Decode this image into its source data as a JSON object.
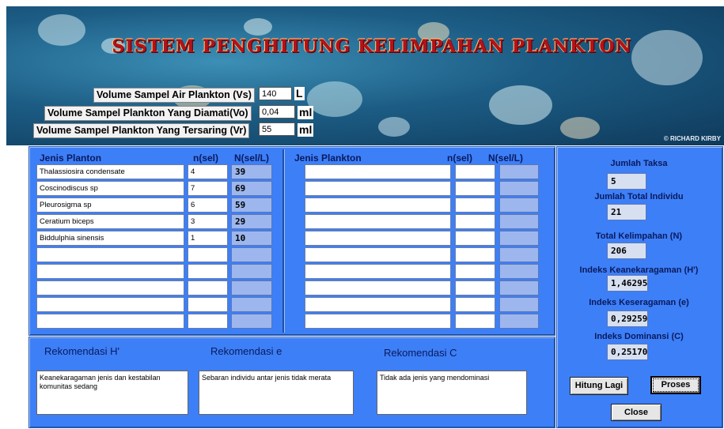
{
  "app": {
    "title": "SISTEM PENGHITUNG KELIMPAHAN PLANKTON",
    "banner_watermark": "© RICHARD KIRBY"
  },
  "volumes": [
    {
      "label": "Volume Sampel Air Plankton (Vs)",
      "value": "140",
      "unit": "L"
    },
    {
      "label": "Volume Sampel Plankton Yang Diamati(Vo)",
      "value": "0,04",
      "unit": "ml"
    },
    {
      "label": "Volume Sampel Plankton Yang Tersaring (Vr)",
      "value": "55",
      "unit": "ml"
    }
  ],
  "table_left": {
    "headers": {
      "jenis": "Jenis Planton",
      "n": "n(sel)",
      "N": "N(sel/L)"
    },
    "rows": [
      {
        "jenis": "Thalassiosira condensate",
        "n": "4",
        "N": "39"
      },
      {
        "jenis": "Coscinodiscus sp",
        "n": "7",
        "N": "69"
      },
      {
        "jenis": "Pleurosigma sp",
        "n": "6",
        "N": "59"
      },
      {
        "jenis": "Ceratium biceps",
        "n": "3",
        "N": "29"
      },
      {
        "jenis": "Biddulphia sinensis",
        "n": "1",
        "N": "10"
      },
      {
        "jenis": "",
        "n": "",
        "N": ""
      },
      {
        "jenis": "",
        "n": "",
        "N": ""
      },
      {
        "jenis": "",
        "n": "",
        "N": ""
      },
      {
        "jenis": "",
        "n": "",
        "N": ""
      },
      {
        "jenis": "",
        "n": "",
        "N": ""
      }
    ]
  },
  "table_right": {
    "headers": {
      "jenis": "Jenis Plankton",
      "n": "n(sel)",
      "N": "N(sel/L)"
    },
    "rows": [
      {
        "jenis": "",
        "n": "",
        "N": ""
      },
      {
        "jenis": "",
        "n": "",
        "N": ""
      },
      {
        "jenis": "",
        "n": "",
        "N": ""
      },
      {
        "jenis": "",
        "n": "",
        "N": ""
      },
      {
        "jenis": "",
        "n": "",
        "N": ""
      },
      {
        "jenis": "",
        "n": "",
        "N": ""
      },
      {
        "jenis": "",
        "n": "",
        "N": ""
      },
      {
        "jenis": "",
        "n": "",
        "N": ""
      },
      {
        "jenis": "",
        "n": "",
        "N": ""
      },
      {
        "jenis": "",
        "n": "",
        "N": ""
      }
    ]
  },
  "results": {
    "jumlah_taksa": {
      "label": "Jumlah Taksa",
      "value": "5"
    },
    "jumlah_total_individu": {
      "label": "Jumlah Total Individu",
      "value": "21"
    },
    "total_kelimpahan": {
      "label": "Total Kelimpahan (N)",
      "value": "206"
    },
    "indeks_keanekaragaman": {
      "label": "Indeks Keanekaragaman (H')",
      "value": "1,46295"
    },
    "indeks_keseragaman": {
      "label": "Indeks Keseragaman (e)",
      "value": "0,29259"
    },
    "indeks_dominansi": {
      "label": "Indeks Dominansi (C)",
      "value": "0,25170"
    }
  },
  "recommendations": {
    "h": {
      "label": "Rekomendasi H'",
      "text": "Keanekaragaman jenis dan kestabilan komunitas sedang"
    },
    "e": {
      "label": "Rekomendasi e",
      "text": "Sebaran individu antar jenis tidak merata"
    },
    "c": {
      "label": "Rekomendasi C",
      "text": "Tidak ada jenis yang mendominasi"
    }
  },
  "buttons": {
    "hitung_lagi": "Hitung Lagi",
    "proses": "Proses",
    "close": "Close"
  },
  "colors": {
    "panel": "#3d7ff7",
    "title": "#b3121a",
    "result_box": "#d7e0f1",
    "n_cell": "#9db7ee"
  }
}
